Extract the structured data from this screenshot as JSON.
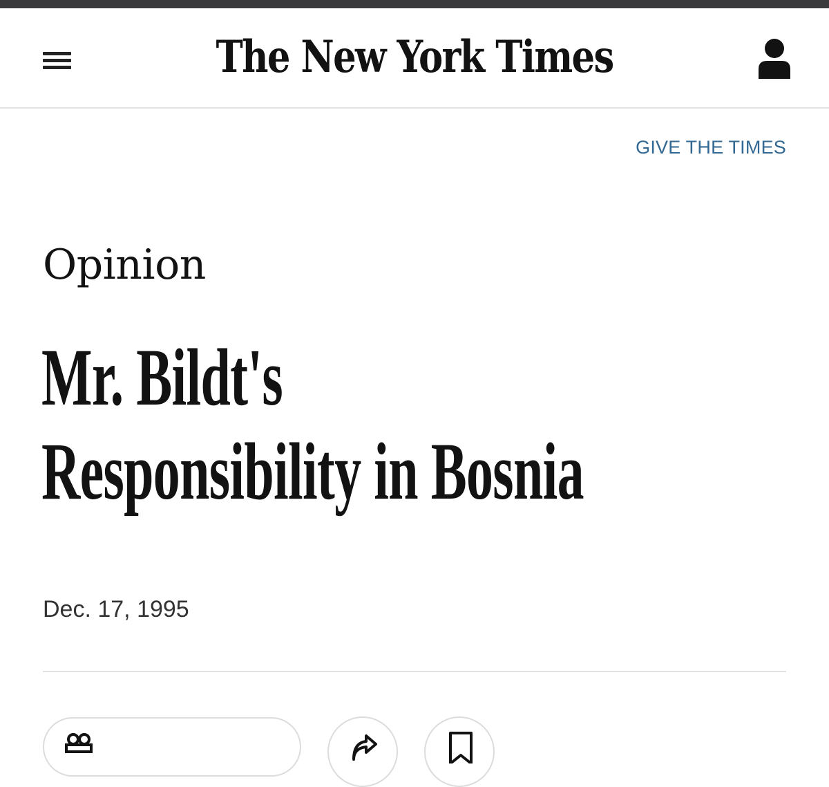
{
  "header": {
    "logo_text": "The New York Times",
    "menu_icon": "hamburger-menu-icon",
    "account_icon": "user-account-icon"
  },
  "promo": {
    "give_label": "GIVE THE TIMES"
  },
  "article": {
    "section": "Opinion",
    "headline_lines": [
      "Mr. Bildt's",
      "Responsibility in Bosnia"
    ],
    "date": "Dec. 17, 1995"
  },
  "actions": {
    "share_full_icon": "gift-icon",
    "share_icon": "share-arrow-icon",
    "save_icon": "bookmark-icon"
  },
  "colors": {
    "link": "#326891",
    "text": "#121212",
    "rule": "#e2e2e2",
    "top_strip": "#3a3a3c"
  }
}
